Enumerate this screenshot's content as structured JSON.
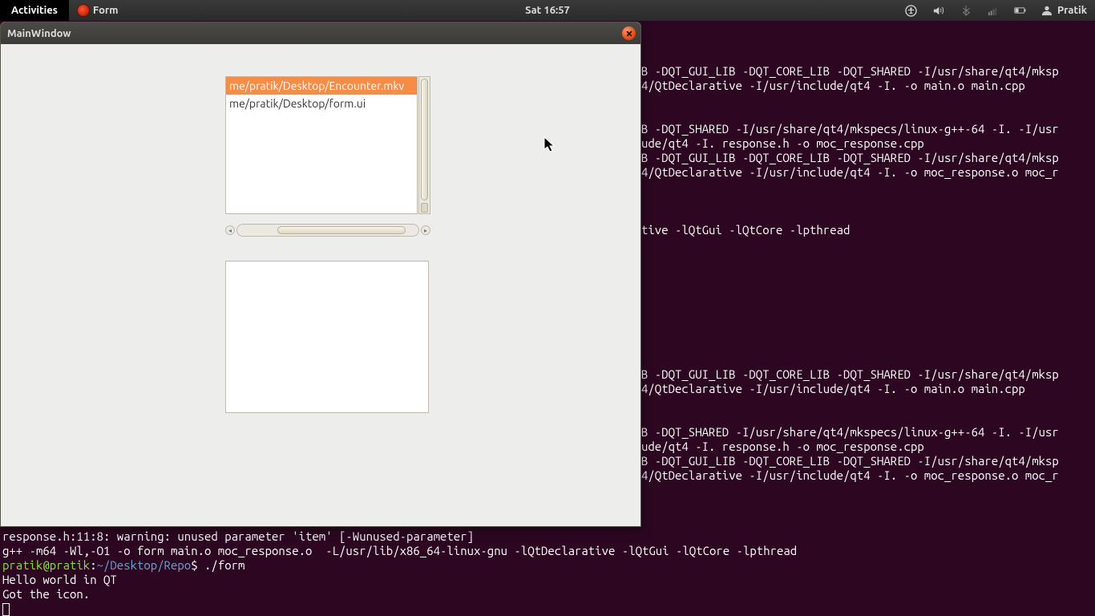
{
  "panel": {
    "activities": "Activities",
    "app_name": "Form",
    "clock": "Sat 16:57",
    "user": "Pratik"
  },
  "window": {
    "title": "MainWindow",
    "list_items": [
      "me/pratik/Desktop/Encounter.mkv",
      "me/pratik/Desktop/form.ui"
    ]
  },
  "terminal": {
    "right_lines": [
      "",
      "",
      "",
      "B -DQT_GUI_LIB -DQT_CORE_LIB -DQT_SHARED -I/usr/share/qt4/mksp",
      "4/QtDeclarative -I/usr/include/qt4 -I. -o main.o main.cpp",
      "",
      "",
      "B -DQT_SHARED -I/usr/share/qt4/mkspecs/linux-g++-64 -I. -I/usr",
      "ude/qt4 -I. response.h -o moc_response.cpp",
      "B -DQT_GUI_LIB -DQT_CORE_LIB -DQT_SHARED -I/usr/share/qt4/mksp",
      "4/QtDeclarative -I/usr/include/qt4 -I. -o moc_response.o moc_r",
      "",
      "",
      "",
      "tive -lQtGui -lQtCore -lpthread",
      "",
      "",
      "",
      "",
      "",
      "",
      "",
      "",
      "",
      "B -DQT_GUI_LIB -DQT_CORE_LIB -DQT_SHARED -I/usr/share/qt4/mksp",
      "4/QtDeclarative -I/usr/include/qt4 -I. -o main.o main.cpp",
      "",
      "",
      "B -DQT_SHARED -I/usr/share/qt4/mkspecs/linux-g++-64 -I. -I/usr",
      "ude/qt4 -I. response.h -o moc_response.cpp",
      "B -DQT_GUI_LIB -DQT_CORE_LIB -DQT_SHARED -I/usr/share/qt4/mksp",
      "4/QtDeclarative -I/usr/include/qt4 -I. -o moc_response.o moc_r"
    ],
    "bottom_lines": [
      "response.h:11:8: warning: unused parameter 'item' [-Wunused-parameter]",
      "g++ -m64 -Wl,-O1 -o form main.o moc_response.o  -L/usr/lib/x86_64-linux-gnu -lQtDeclarative -lQtGui -lQtCore -lpthread",
      "pratik@pratik:~/Desktop/Repo$ ./form",
      "Hello world in QT",
      "Got the icon."
    ]
  }
}
